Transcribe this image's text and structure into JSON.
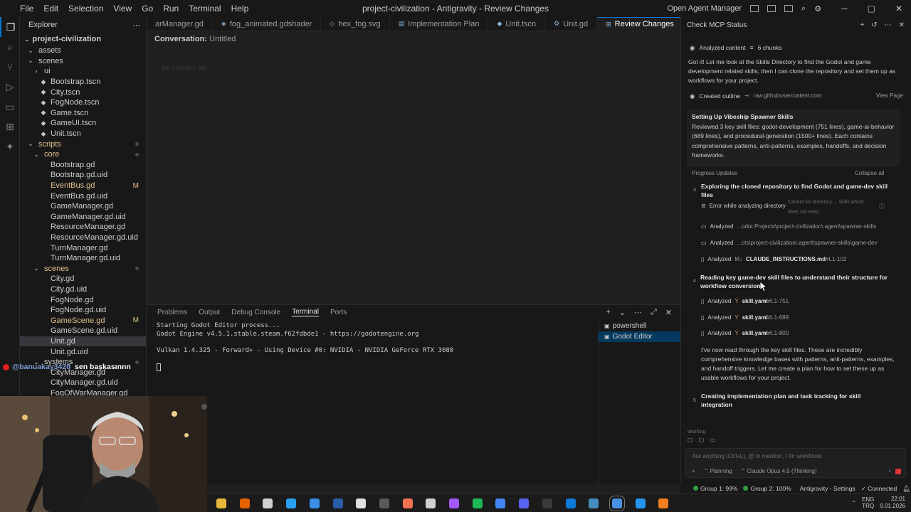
{
  "window": {
    "title": "project-civilization - Antigravity - Review Changes",
    "menu": [
      "File",
      "Edit",
      "Selection",
      "View",
      "Go",
      "Run",
      "Terminal",
      "Help"
    ],
    "open_agent_manager": "Open Agent Manager"
  },
  "explorer": {
    "header": "Explorer",
    "project": "project-civilization",
    "rows": [
      {
        "label": "assets",
        "indent": 1,
        "type": "folder",
        "open": true
      },
      {
        "label": "scenes",
        "indent": 1,
        "type": "folder",
        "open": true
      },
      {
        "label": "ui",
        "indent": 2,
        "type": "folder",
        "open": false
      },
      {
        "label": "Bootstrap.tscn",
        "indent": 2,
        "type": "tscn"
      },
      {
        "label": "City.tscn",
        "indent": 2,
        "type": "tscn"
      },
      {
        "label": "FogNode.tscn",
        "indent": 2,
        "type": "tscn"
      },
      {
        "label": "Game.tscn",
        "indent": 2,
        "type": "tscn"
      },
      {
        "label": "GameUI.tscn",
        "indent": 2,
        "type": "tscn"
      },
      {
        "label": "Unit.tscn",
        "indent": 2,
        "type": "tscn"
      },
      {
        "label": "scripts",
        "indent": 1,
        "type": "folder",
        "open": true,
        "color": "m",
        "dot": true
      },
      {
        "label": "core",
        "indent": 2,
        "type": "folder",
        "open": true,
        "color": "m",
        "dot": true
      },
      {
        "label": "Bootstrap.gd",
        "indent": 3,
        "type": "gd"
      },
      {
        "label": "Bootstrap.gd.uid",
        "indent": 3,
        "type": "uid"
      },
      {
        "label": "EventBus.gd",
        "indent": 3,
        "type": "gd",
        "color": "m",
        "mod": "M"
      },
      {
        "label": "EventBus.gd.uid",
        "indent": 3,
        "type": "uid"
      },
      {
        "label": "GameManager.gd",
        "indent": 3,
        "type": "gd"
      },
      {
        "label": "GameManager.gd.uid",
        "indent": 3,
        "type": "uid"
      },
      {
        "label": "ResourceManager.gd",
        "indent": 3,
        "type": "gd"
      },
      {
        "label": "ResourceManager.gd.uid",
        "indent": 3,
        "type": "uid"
      },
      {
        "label": "TurnManager.gd",
        "indent": 3,
        "type": "gd"
      },
      {
        "label": "TurnManager.gd.uid",
        "indent": 3,
        "type": "uid"
      },
      {
        "label": "scenes",
        "indent": 2,
        "type": "folder",
        "open": true,
        "color": "m",
        "dot": true
      },
      {
        "label": "City.gd",
        "indent": 3,
        "type": "gd"
      },
      {
        "label": "City.gd.uid",
        "indent": 3,
        "type": "uid"
      },
      {
        "label": "FogNode.gd",
        "indent": 3,
        "type": "gd"
      },
      {
        "label": "FogNode.gd.uid",
        "indent": 3,
        "type": "uid"
      },
      {
        "label": "GameScene.gd",
        "indent": 3,
        "type": "gd",
        "color": "m",
        "mod": "M"
      },
      {
        "label": "GameScene.gd.uid",
        "indent": 3,
        "type": "uid"
      },
      {
        "label": "Unit.gd",
        "indent": 3,
        "type": "gd",
        "selected": true
      },
      {
        "label": "Unit.gd.uid",
        "indent": 3,
        "type": "uid"
      },
      {
        "label": "systems",
        "indent": 2,
        "type": "folder",
        "open": true,
        "dot": true
      },
      {
        "label": "CityManager.gd",
        "indent": 3,
        "type": "gd"
      },
      {
        "label": "CityManager.gd.uid",
        "indent": 3,
        "type": "uid"
      },
      {
        "label": "FogOfWarManager.gd",
        "indent": 3,
        "type": "gd"
      }
    ]
  },
  "tabs": [
    {
      "label": "arManager.gd",
      "icon": "gd"
    },
    {
      "label": "fog_animated.gdshader",
      "icon": "shader"
    },
    {
      "label": "hex_fog.svg",
      "icon": "svg"
    },
    {
      "label": "Implementation Plan",
      "icon": "doc"
    },
    {
      "label": "Unit.tscn",
      "icon": "tscn"
    },
    {
      "label": "Unit.gd",
      "icon": "gd"
    },
    {
      "label": "Review Changes",
      "icon": "review",
      "active": true
    }
  ],
  "editor": {
    "conversation_label": "Conversation:",
    "conversation_value": "Untitled",
    "empty_hint": "No changes yet"
  },
  "panel": {
    "tabs": [
      "Problems",
      "Output",
      "Debug Console",
      "Terminal",
      "Ports"
    ],
    "active_tab": "Terminal",
    "terminal_lines": [
      "Starting Godot Editor process...",
      "Godot Engine v4.5.1.stable.steam.f62fdbde1 - https://godotengine.org",
      "",
      "Vulkan 1.4.325 - Forward+ - Using Device #0: NVIDIA - NVIDIA GeForce RTX 3080"
    ],
    "terminals": [
      {
        "label": "powershell",
        "selected": false
      },
      {
        "label": "Godot Editor",
        "selected": true
      }
    ]
  },
  "agent": {
    "header": "Check MCP Status",
    "analyzed_content": "Analyzed content",
    "chunks": "6 chunks",
    "message1": "Got it! Let me look at the Skills Directory to find the Godot and game development related skills, then I can clone the repository and set them up as workflows for your project.",
    "created_outline": "Created outline",
    "outline_source": "raw.githubusercontent.com",
    "view_page": "View Page",
    "card_title": "Setting Up Vibeship Spawner Skills",
    "card_body": "Reviewed 3 key skill files: godot-development (751 lines), game-ai-behavior (689 lines), and procedural-generation (1500+ lines). Each contains comprehensive patterns, anti-patterns, examples, handoffs, and decision frameworks.",
    "progress_updates": "Progress Updates",
    "collapse_all": "Collapse all",
    "step3_num": "3",
    "step3_title": "Exploring the cloned repository to find Godot and game-dev skill files",
    "error_text": "Error while analyzing directory",
    "error_detail": "Cannot list directory ... skills which does not exist.",
    "analyzed_1_label": "Analyzed",
    "analyzed_1_path": "...odot Projects\\project-civilization\\.agent\\spawner-skills",
    "analyzed_2_label": "Analyzed",
    "analyzed_2_path": "...cts\\project-civilization\\.agent\\spawner-skills\\game-dev",
    "analyzed_3_label": "Analyzed",
    "analyzed_3_file": "CLAUDE_INSTRUCTIONS.md",
    "analyzed_3_range": "#L1-102",
    "step4_num": "4",
    "step4_title": "Reading key game-dev skill files to understand their structure for workflow conversion",
    "yaml_rows": [
      {
        "label": "Analyzed",
        "file": "skill.yaml",
        "range": "#L1-751"
      },
      {
        "label": "Analyzed",
        "file": "skill.yaml",
        "range": "#L1-689"
      },
      {
        "label": "Analyzed",
        "file": "skill.yaml",
        "range": "#L1-800"
      }
    ],
    "message2": "I've now read through the key skill files. These are incredibly comprehensive knowledge bases with patterns, anti-patterns, examples, and handoff triggers. Let me create a plan for how to set these up as usable workflows for your project.",
    "step5_num": "5",
    "step5_title": "Creating implementation plan and task tracking for skill integration",
    "working": "Working",
    "input_placeholder": "Ask anything (Ctrl+L), @ to mention, / for workflows",
    "mode": "Planning",
    "model": "Claude Opus 4.5 (Thinking)"
  },
  "statusbar": {
    "group1": "Group 1: 99%",
    "group2": "Group 2: 100%",
    "settings": "Antigravity - Settings",
    "connected": "Connected"
  },
  "taskbar": {
    "lang1": "ENG",
    "lang2": "TRQ",
    "time": "22:01",
    "date": "9.01.2026"
  },
  "stream_overlay": {
    "username": "@banuakay3428",
    "message": "sen başkasınnn"
  },
  "colors": {
    "accent": "#0078d4",
    "modified": "#e2c08d",
    "status_green": "#2ea043",
    "stop_red": "#dd3333"
  }
}
